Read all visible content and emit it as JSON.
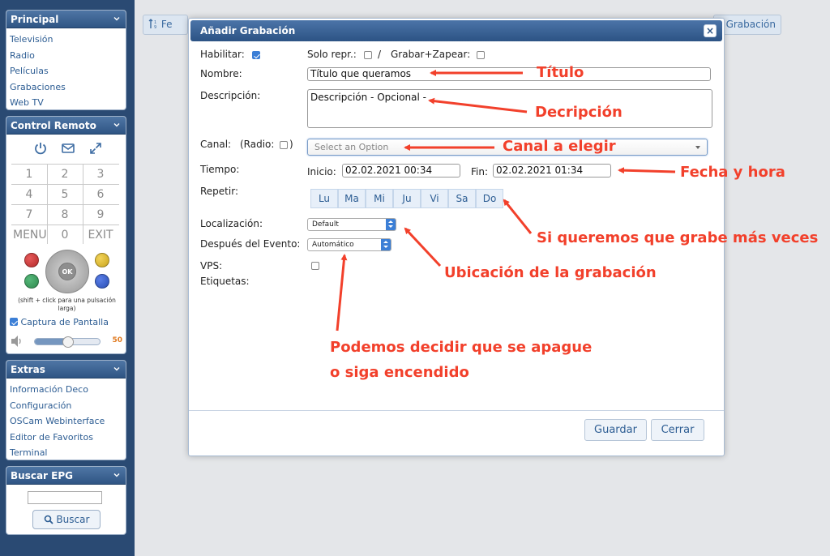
{
  "sidebar": {
    "principal": {
      "title": "Principal",
      "items": [
        "Televisión",
        "Radio",
        "Películas",
        "Grabaciones",
        "Web TV"
      ]
    },
    "control": {
      "title": "Control Remoto",
      "keys": [
        "1",
        "2",
        "3",
        "4",
        "5",
        "6",
        "7",
        "8",
        "9",
        "MENU",
        "0",
        "EXIT"
      ],
      "ok_label": "OK",
      "hint": "(shift + click para una pulsación larga)",
      "capture_label": "Captura de Pantalla",
      "volume": "50",
      "button_colors": {
        "red": "#b52a2a",
        "yellow": "#c9a51d",
        "green": "#2f8a4e",
        "blue": "#2a4fb5"
      }
    },
    "extras": {
      "title": "Extras",
      "items": [
        "Información Deco",
        "Configuración",
        "OSCam Webinterface",
        "Editor de Favoritos",
        "Terminal"
      ]
    },
    "epg": {
      "title": "Buscar EPG",
      "button": "Buscar"
    }
  },
  "background": {
    "left_button": "Fe",
    "right_button": "Grabación"
  },
  "dialog": {
    "title": "Añadir Grabación",
    "close": "×",
    "habilitar": "Habilitar:",
    "solo_repr": "Solo repr.:",
    "slash": "/",
    "grabar_zapear": "Grabar+Zapear:",
    "nombre_label": "Nombre:",
    "nombre_value": "Título que queramos",
    "descripcion_label": "Descripción:",
    "descripcion_value": "Descripción - Opcional -",
    "canal_label": "Canal:",
    "radio_label": "(Radio:",
    "radio_close": ")",
    "canal_placeholder": "Select an Option",
    "tiempo_label": "Tiempo:",
    "inicio_label": "Inicio:",
    "inicio_value": "02.02.2021 00:34",
    "fin_label": "Fin:",
    "fin_value": "02.02.2021 01:34",
    "repetir_label": "Repetir:",
    "days": [
      "Lu",
      "Ma",
      "Mi",
      "Ju",
      "Vi",
      "Sa",
      "Do"
    ],
    "localizacion_label": "Localización:",
    "localizacion_value": "Default",
    "despues_label": "Después del Evento:",
    "despues_value": "Automático",
    "vps_label": "VPS:",
    "etiquetas_label": "Etiquetas:",
    "guardar": "Guardar",
    "cerrar": "Cerrar"
  },
  "annotations": {
    "titulo": "Título",
    "descripcion": "Decripción",
    "canal": "Canal a elegir",
    "fecha": "Fecha y hora",
    "repetir": "Si queremos que grabe más veces",
    "ubicacion": "Ubicación de la grabación",
    "apagar_1": "Podemos decidir que se apague",
    "apagar_2": "o siga encendido"
  },
  "colors": {
    "annotation": "#f2402b",
    "header": "#2f5584",
    "link": "#2d5d93"
  }
}
